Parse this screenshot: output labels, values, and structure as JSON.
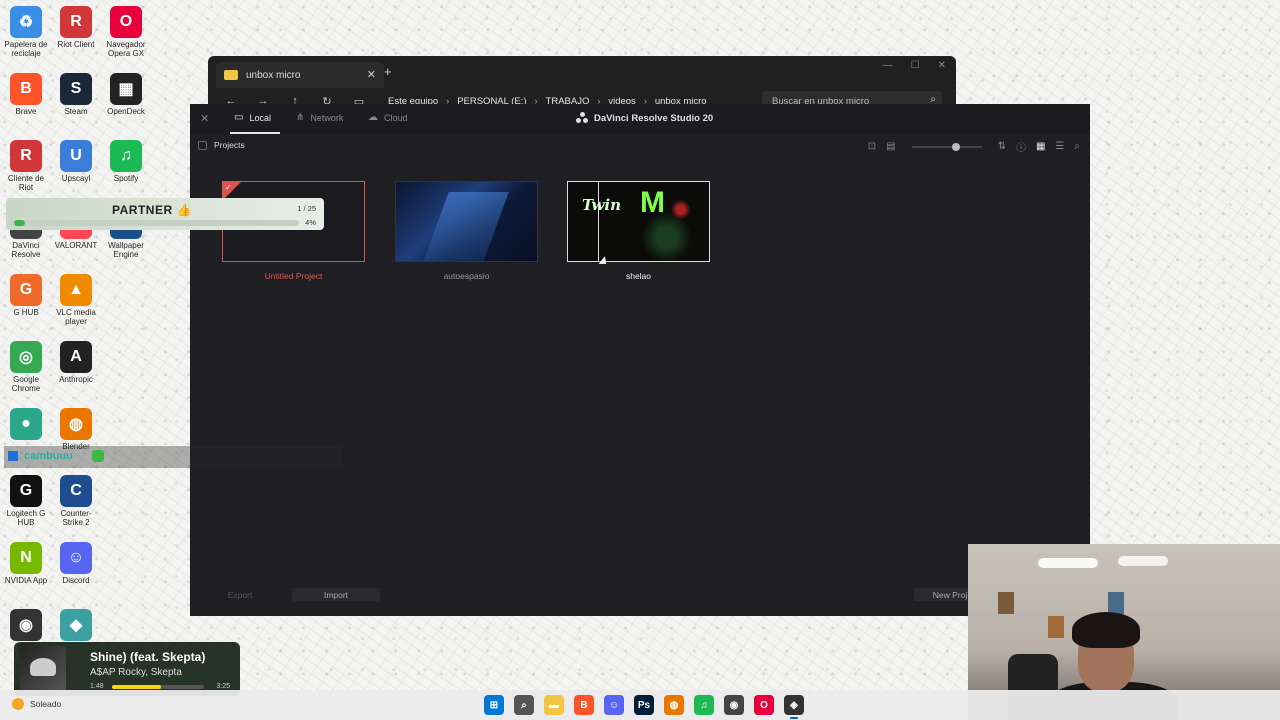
{
  "desktop": {
    "icons_col1": [
      {
        "label": "Papelera de reciclaje",
        "color": "#3a8ee6",
        "glyph": "♻"
      },
      {
        "label": "Brave",
        "color": "#fb542b",
        "glyph": "B"
      },
      {
        "label": "Cliente de Riot",
        "color": "#d13639",
        "glyph": "R"
      },
      {
        "label": "DaVinci Resolve",
        "color": "#444444",
        "glyph": "D"
      },
      {
        "label": "G HUB",
        "color": "#f06a2b",
        "glyph": "G"
      },
      {
        "label": "Google Chrome",
        "color": "#34a853",
        "glyph": "◎"
      },
      {
        "label": "",
        "color": "#2ba889",
        "glyph": "●"
      },
      {
        "label": "Logitech G HUB",
        "color": "#111111",
        "glyph": "G"
      },
      {
        "label": "NVIDIA App",
        "color": "#76b900",
        "glyph": "N"
      },
      {
        "label": "OBS",
        "color": "#333333",
        "glyph": "◉"
      }
    ],
    "icons_col2": [
      {
        "label": "Riot Client",
        "color": "#d13639",
        "glyph": "R"
      },
      {
        "label": "Steam",
        "color": "#1b2838",
        "glyph": "S"
      },
      {
        "label": "Upscayl",
        "color": "#3c7dd9",
        "glyph": "U"
      },
      {
        "label": "VALORANT",
        "color": "#ff4655",
        "glyph": "V"
      },
      {
        "label": "VLC media player",
        "color": "#f08a00",
        "glyph": "▲"
      },
      {
        "label": "Anthropic",
        "color": "#222222",
        "glyph": "A"
      },
      {
        "label": "Blender",
        "color": "#ea7600",
        "glyph": "◍"
      },
      {
        "label": "Counter-Strike 2",
        "color": "#1e4d8f",
        "glyph": "C"
      },
      {
        "label": "Discord",
        "color": "#5865f2",
        "glyph": "☺"
      },
      {
        "label": "",
        "color": "#3aa0a0",
        "glyph": "◆"
      }
    ],
    "icons_col3": [
      {
        "label": "Navegador Opera GX",
        "color": "#e8003c",
        "glyph": "O"
      },
      {
        "label": "OpenDeck",
        "color": "#222222",
        "glyph": "▦"
      },
      {
        "label": "Spotify",
        "color": "#1db954",
        "glyph": "♫"
      },
      {
        "label": "Wallpaper Engine",
        "color": "#1c4f8a",
        "glyph": "W"
      }
    ]
  },
  "explorer": {
    "tab_title": "unbox micro",
    "new_tab": "+",
    "close": "✕",
    "nav": {
      "back": "←",
      "forward": "→",
      "up": "↑",
      "refresh": "↻",
      "monitor": "▭"
    },
    "breadcrumbs": [
      "Este equipo",
      "PERSONAL (E:)",
      "TRABAJO",
      "videos",
      "unbox micro"
    ],
    "search_placeholder": "Buscar en unbox micro",
    "window_controls": [
      "—",
      "☐",
      "✕"
    ]
  },
  "resolve": {
    "title": "DaVinci Resolve Studio 20",
    "location_tabs": [
      {
        "label": "Local",
        "active": true
      },
      {
        "label": "Network",
        "active": false
      },
      {
        "label": "Cloud",
        "active": false
      }
    ],
    "close": "✕",
    "section_label": "Projects",
    "projects": [
      {
        "name": "Untitled Project",
        "state": "selected"
      },
      {
        "name": "autoespasio",
        "state": "normal"
      },
      {
        "name": "shelao",
        "state": "hover"
      }
    ],
    "thumb_text": {
      "twin": "Twin",
      "monster": "M"
    },
    "buttons": {
      "export": "Export",
      "import": "Import",
      "new_project": "New Proj"
    }
  },
  "overlay": {
    "partner": {
      "title": "PARTNER",
      "emoji": "👍",
      "count": "1 / 25",
      "percent": "4%",
      "progress": 0.04
    },
    "chat_user": "cambuuu"
  },
  "spotify": {
    "song": "Shine) (feat. Skepta)",
    "artist": "A$AP Rocky, Skepta",
    "elapsed": "1:48",
    "duration": "3:25",
    "progress": 0.53
  },
  "taskbar": {
    "weather": "Soleado",
    "apps": [
      {
        "name": "windows-start",
        "color": "#0078d4",
        "glyph": "⊞"
      },
      {
        "name": "search",
        "color": "#555555",
        "glyph": "⌕"
      },
      {
        "name": "file-explorer",
        "color": "#f4c542",
        "glyph": "▬"
      },
      {
        "name": "brave",
        "color": "#fb542b",
        "glyph": "B"
      },
      {
        "name": "discord",
        "color": "#5865f2",
        "glyph": "☺"
      },
      {
        "name": "photoshop",
        "color": "#001e36",
        "glyph": "Ps"
      },
      {
        "name": "blender",
        "color": "#ea7600",
        "glyph": "◍"
      },
      {
        "name": "spotify",
        "color": "#1db954",
        "glyph": "♫"
      },
      {
        "name": "obs",
        "color": "#444444",
        "glyph": "◉"
      },
      {
        "name": "opera-gx",
        "color": "#e8003c",
        "glyph": "O"
      },
      {
        "name": "davinci-resolve",
        "color": "#333333",
        "glyph": "◈"
      }
    ]
  }
}
